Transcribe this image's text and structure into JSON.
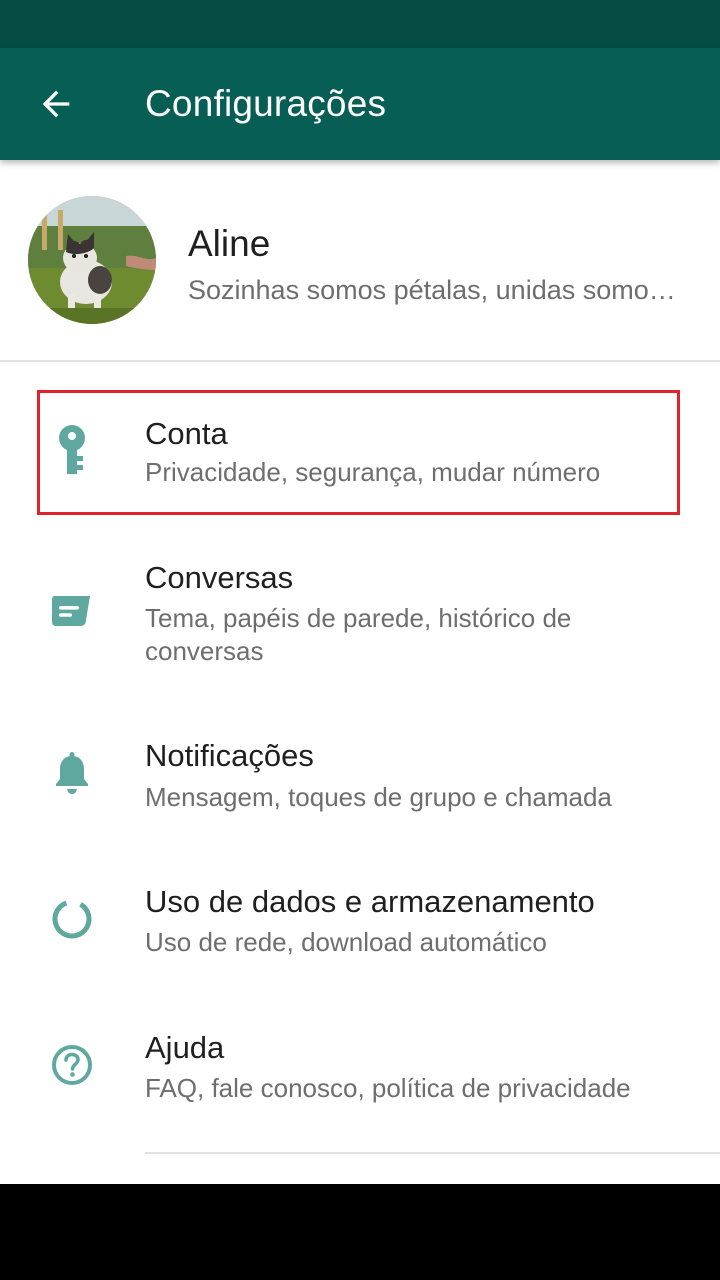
{
  "colors": {
    "status_bar": "#054d44",
    "app_bar": "#075e54",
    "accent_icon": "#5fa8a0",
    "highlight_border": "#e0232b"
  },
  "header": {
    "title": "Configurações",
    "back_icon": "arrow-left-icon"
  },
  "profile": {
    "name": "Aline",
    "status": "Sozinhas somos pétalas, unidas somos uma flor",
    "avatar_icon": "cat-photo-avatar"
  },
  "items": [
    {
      "title": "Conta",
      "subtitle": "Privacidade, segurança, mudar número",
      "icon": "key-icon",
      "highlighted": true
    },
    {
      "title": "Conversas",
      "subtitle": "Tema, papéis de parede, histórico de conversas",
      "icon": "chat-icon",
      "highlighted": false
    },
    {
      "title": "Notificações",
      "subtitle": "Mensagem, toques de grupo e chamada",
      "icon": "bell-icon",
      "highlighted": false
    },
    {
      "title": "Uso de dados e armazenamento",
      "subtitle": "Uso de rede, download automático",
      "icon": "data-usage-icon",
      "highlighted": false
    },
    {
      "title": "Ajuda",
      "subtitle": "FAQ, fale conosco, política de privacidade",
      "icon": "help-icon",
      "highlighted": false
    }
  ]
}
